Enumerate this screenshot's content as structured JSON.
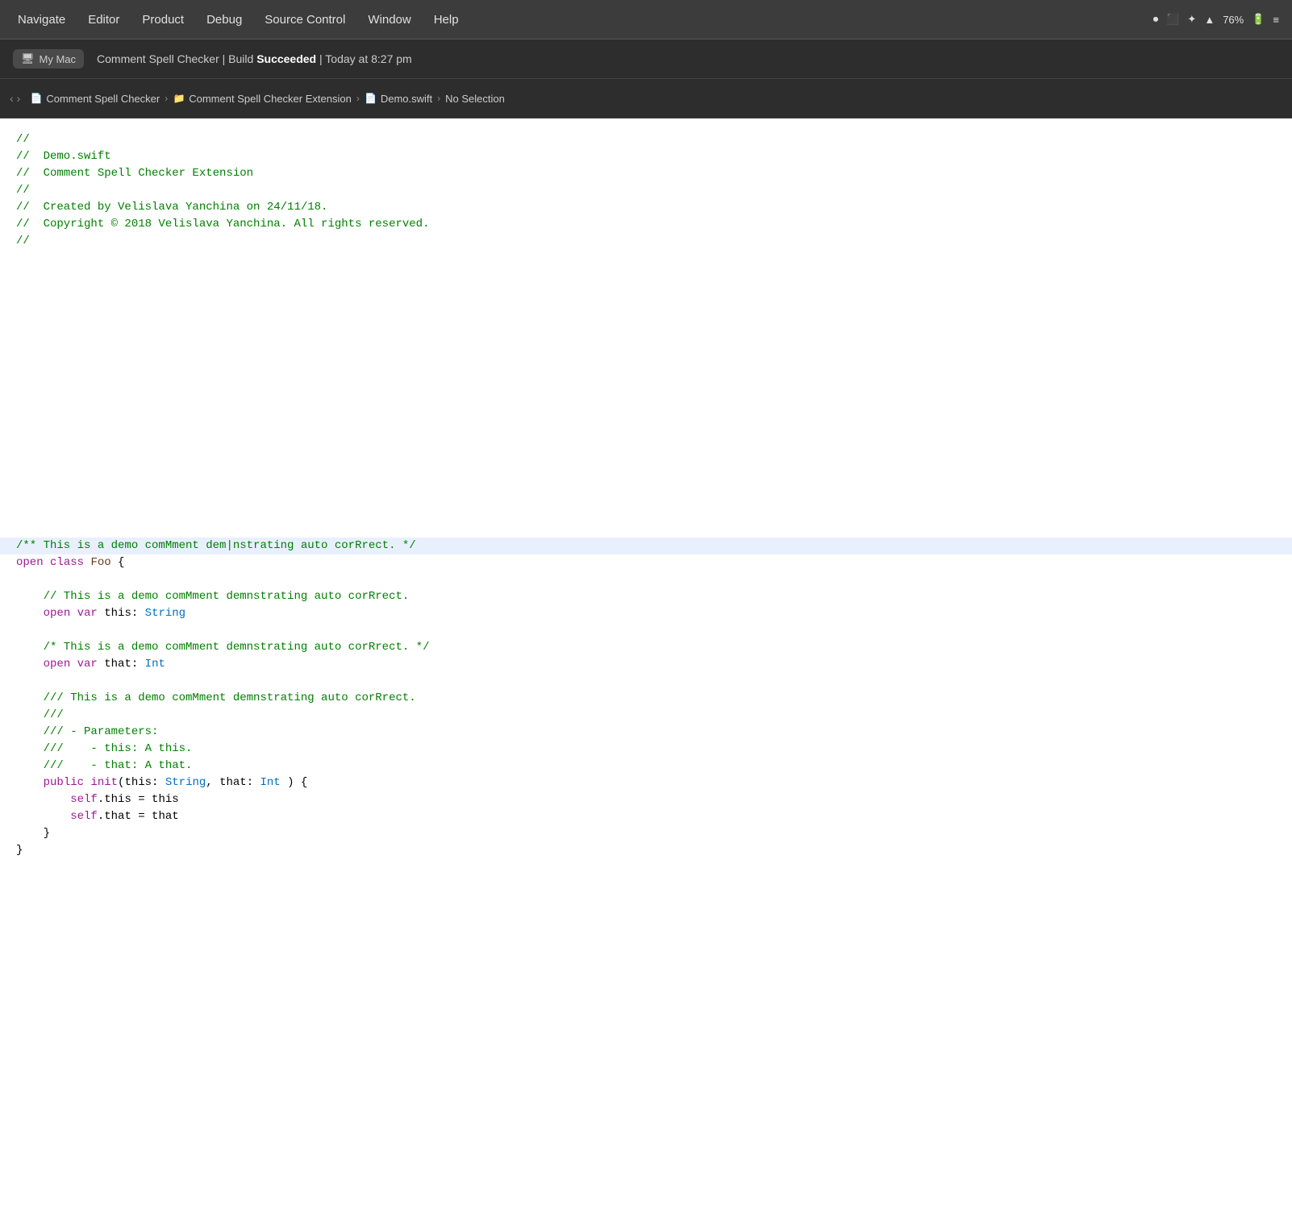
{
  "titleBar": {
    "menuItems": [
      {
        "id": "navigate",
        "label": "Navigate"
      },
      {
        "id": "editor",
        "label": "Editor"
      },
      {
        "id": "product",
        "label": "Product"
      },
      {
        "id": "debug",
        "label": "Debug"
      },
      {
        "id": "sourceControl",
        "label": "Source Control"
      },
      {
        "id": "window",
        "label": "Window"
      },
      {
        "id": "help",
        "label": "Help"
      }
    ],
    "systemIcons": {
      "record": "⏺",
      "airplay": "⬜",
      "bluetooth": "✦",
      "wifi": "▲",
      "battery": "76%"
    }
  },
  "buildBar": {
    "deviceLabel": "My Mac",
    "projectLabel": "Comment Spell Checker Extension",
    "statusText": "Comment Spell Checker | Build ",
    "statusBold": "Succeeded",
    "statusTime": " | Today at 8:27 pm"
  },
  "breadcrumb": {
    "items": [
      {
        "label": "Comment Spell Checker",
        "icon": "📄"
      },
      {
        "label": "Comment Spell Checker Extension",
        "icon": "📁"
      },
      {
        "label": "Demo.swift",
        "icon": "📄"
      },
      {
        "label": "No Selection"
      }
    ]
  },
  "code": {
    "lines": [
      {
        "text": "//",
        "type": "comment"
      },
      {
        "text": "//  Demo.swift",
        "type": "comment"
      },
      {
        "text": "//  Comment Spell Checker Extension",
        "type": "comment"
      },
      {
        "text": "//",
        "type": "comment"
      },
      {
        "text": "//  Created by Velislava Yanchina on 24/11/18.",
        "type": "comment"
      },
      {
        "text": "//  Copyright © 2018 Velislava Yanchina. All rights reserved.",
        "type": "comment"
      },
      {
        "text": "//",
        "type": "comment"
      },
      {
        "text": "",
        "type": "plain"
      },
      {
        "text": "",
        "type": "plain"
      },
      {
        "text": "",
        "type": "plain"
      },
      {
        "text": "",
        "type": "plain"
      },
      {
        "text": "",
        "type": "plain"
      },
      {
        "text": "",
        "type": "plain"
      },
      {
        "text": "",
        "type": "plain"
      },
      {
        "text": "",
        "type": "plain"
      },
      {
        "text": "",
        "type": "plain"
      },
      {
        "text": "",
        "type": "plain"
      },
      {
        "text": "",
        "type": "plain"
      },
      {
        "text": "",
        "type": "plain"
      },
      {
        "text": "",
        "type": "plain"
      },
      {
        "text": "",
        "type": "plain"
      },
      {
        "text": "",
        "type": "plain"
      },
      {
        "text": "",
        "type": "plain"
      },
      {
        "text": "",
        "type": "plain"
      },
      {
        "text": "/** This is a demo comMment dem|nstrating auto corRrect. */",
        "type": "doc-comment",
        "highlighted": true
      },
      {
        "text": "open class Foo {",
        "type": "mixed-class"
      },
      {
        "text": "",
        "type": "plain"
      },
      {
        "text": "    // This is a demo comMment demnstrating auto corRrect.",
        "type": "comment",
        "indent": 4
      },
      {
        "text": "    open var this: String",
        "type": "mixed-var",
        "indent": 4
      },
      {
        "text": "",
        "type": "plain"
      },
      {
        "text": "    /* This is a demo comMment demnstrating auto corRrect. */",
        "type": "comment",
        "indent": 4
      },
      {
        "text": "    open var that: Int",
        "type": "mixed-var2",
        "indent": 4
      },
      {
        "text": "",
        "type": "plain"
      },
      {
        "text": "    /// This is a demo comMment demnstrating auto corRrect.",
        "type": "comment",
        "indent": 4
      },
      {
        "text": "    ///",
        "type": "comment",
        "indent": 4
      },
      {
        "text": "    /// - Parameters:",
        "type": "comment",
        "indent": 4
      },
      {
        "text": "    ///    - this: A this.",
        "type": "comment",
        "indent": 4
      },
      {
        "text": "    ///    - that: A that.",
        "type": "comment",
        "indent": 4
      },
      {
        "text": "    public init(this: String, that: Int ) {",
        "type": "mixed-init",
        "indent": 4
      },
      {
        "text": "        self.this = this",
        "type": "mixed-self",
        "indent": 8
      },
      {
        "text": "        self.that = that",
        "type": "mixed-self2",
        "indent": 8
      },
      {
        "text": "    }",
        "type": "plain",
        "indent": 4
      },
      {
        "text": "}",
        "type": "plain"
      }
    ]
  }
}
